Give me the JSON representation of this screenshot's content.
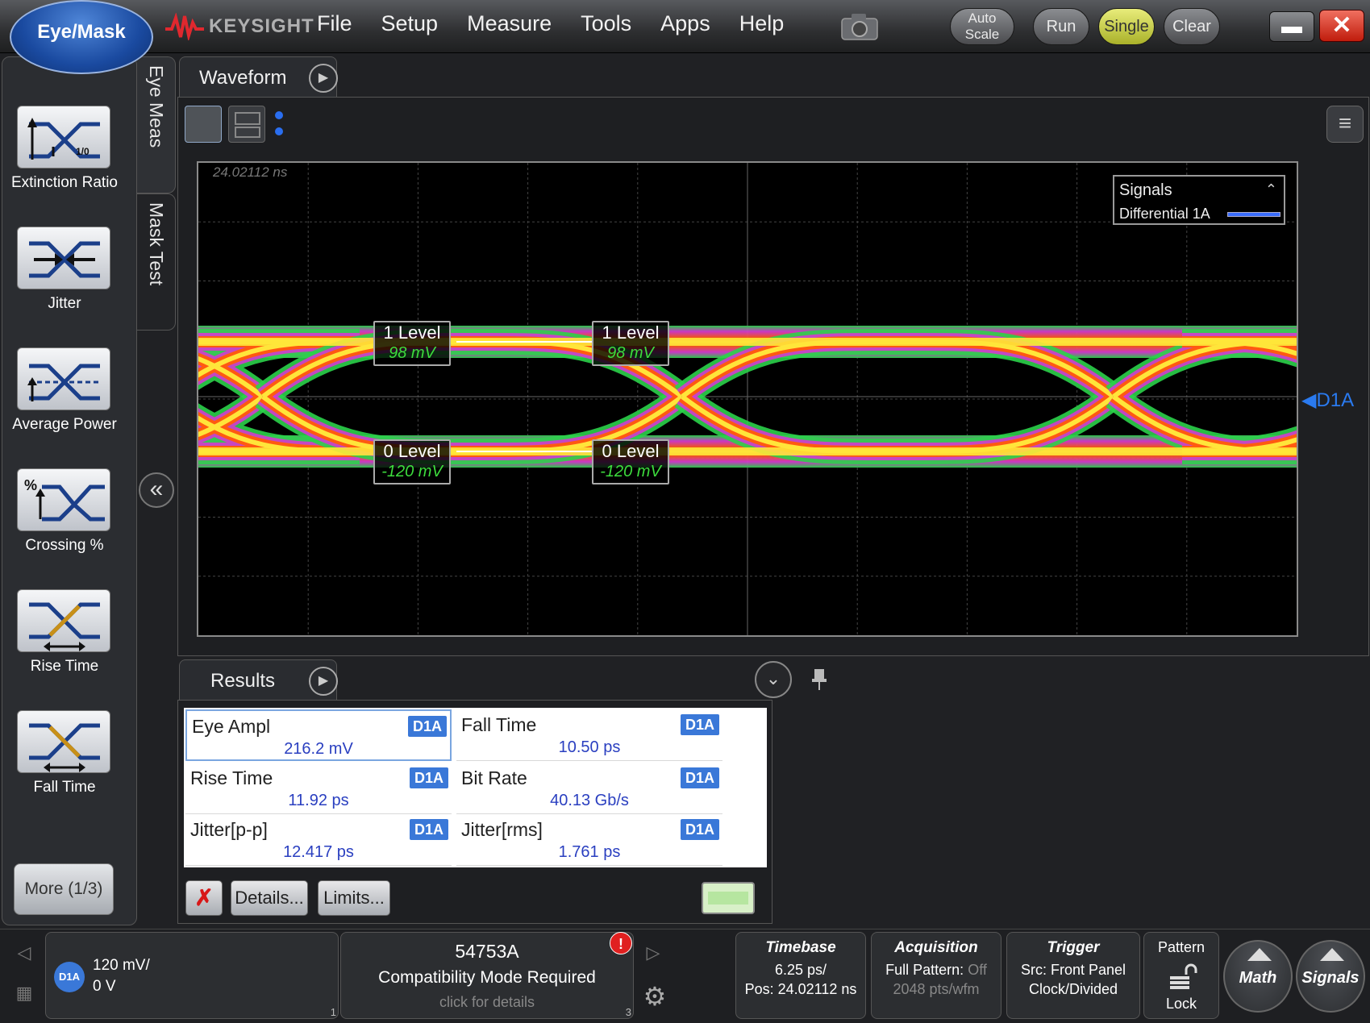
{
  "app": {
    "mode_button": "Eye/Mask",
    "brand": "KEYSIGHT"
  },
  "menu": [
    "File",
    "Setup",
    "Measure",
    "Tools",
    "Apps",
    "Help"
  ],
  "toolbar": {
    "autoscale_line1": "Auto",
    "autoscale_line2": "Scale",
    "run": "Run",
    "single": "Single",
    "clear": "Clear"
  },
  "sidebar": {
    "tools": [
      {
        "label": "Extinction Ratio",
        "icon": "extinction-ratio-icon"
      },
      {
        "label": "Jitter",
        "icon": "jitter-icon"
      },
      {
        "label": "Average Power",
        "icon": "average-power-icon"
      },
      {
        "label": "Crossing %",
        "icon": "crossing-percent-icon"
      },
      {
        "label": "Rise Time",
        "icon": "rise-time-icon"
      },
      {
        "label": "Fall Time",
        "icon": "fall-time-icon"
      }
    ],
    "more": "More (1/3)",
    "extinction_icon_text": "1/0"
  },
  "vtabs": {
    "eye_meas": "Eye Meas",
    "mask_test": "Mask Test"
  },
  "waveform": {
    "tab_label": "Waveform",
    "timestamp": "24.02112 ns",
    "signals_title": "Signals",
    "signal_name": "Differential 1A",
    "signal_color": "#3a6dff",
    "channel_marker": "D1A",
    "levels": [
      {
        "title": "1 Level",
        "value": "98 mV"
      },
      {
        "title": "1 Level",
        "value": "98 mV"
      },
      {
        "title": "0 Level",
        "value": "-120 mV"
      },
      {
        "title": "0 Level",
        "value": "-120 mV"
      }
    ]
  },
  "results": {
    "tab_label": "Results",
    "cells": [
      {
        "name": "Eye Ampl",
        "badge": "D1A",
        "value": "216.2 mV"
      },
      {
        "name": "Fall Time",
        "badge": "D1A",
        "value": "10.50 ps"
      },
      {
        "name": "Rise Time",
        "badge": "D1A",
        "value": "11.92 ps"
      },
      {
        "name": "Bit Rate",
        "badge": "D1A",
        "value": "40.13 Gb/s"
      },
      {
        "name": "Jitter[p-p]",
        "badge": "D1A",
        "value": "12.417 ps"
      },
      {
        "name": "Jitter[rms]",
        "badge": "D1A",
        "value": "1.761 ps"
      }
    ],
    "details_label": "Details...",
    "limits_label": "Limits..."
  },
  "status": {
    "channel_badge": "D1A",
    "channel_scale": "120 mV/",
    "channel_offset": "0 V",
    "channel_corner": "1",
    "compat_model": "54753A",
    "compat_message": "Compatibility Mode Required",
    "compat_hint": "click for details",
    "compat_corner": "3",
    "compat_warn": "!",
    "timebase_title": "Timebase",
    "timebase_scale": "6.25 ps/",
    "timebase_pos": "Pos: 24.02112 ns",
    "acq_title": "Acquisition",
    "acq_pattern_label": "Full Pattern:",
    "acq_pattern_state": "Off",
    "acq_pts": "2048 pts/wfm",
    "trig_title": "Trigger",
    "trig_src": "Src: Front Panel",
    "trig_mode": "Clock/Divided",
    "pattern_title": "Pattern",
    "pattern_lock": "Lock",
    "math": "Math",
    "signals": "Signals"
  }
}
